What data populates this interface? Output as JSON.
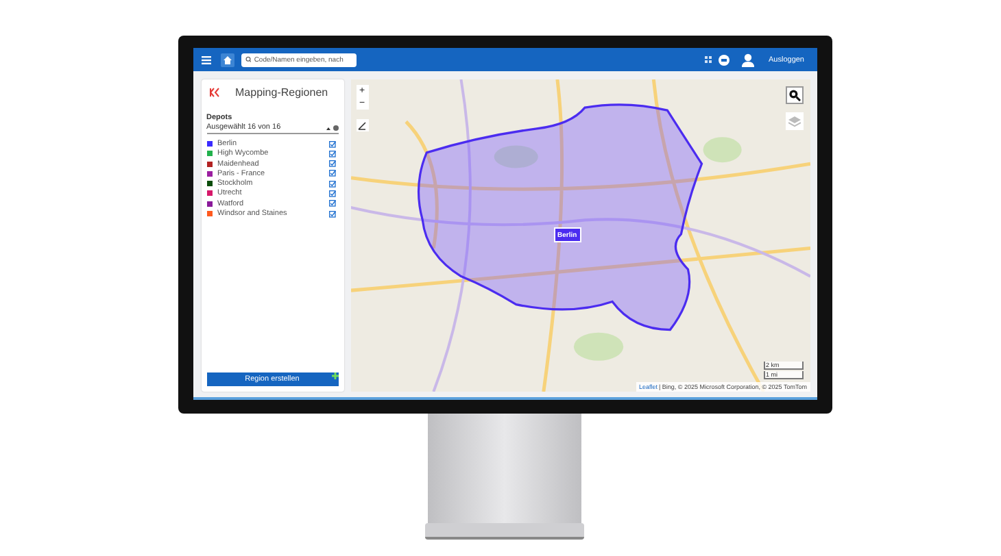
{
  "top_bar": {
    "search": {
      "placeholder": "Code/Namen eingeben, nach"
    },
    "logout": "Ausloggen"
  },
  "panel": {
    "title": "Mapping-Regionen",
    "depots_label": "Depots",
    "selection": "Ausgewählt 16 von 16",
    "depots": [
      {
        "name": "Berlin",
        "color": "#3a2bff",
        "checked": true
      },
      {
        "name": "High Wycombe",
        "color": "#22b14c",
        "checked": true
      },
      {
        "name": "Maidenhead",
        "color": "#b22222",
        "checked": true
      },
      {
        "name": "Paris - France",
        "color": "#9b1fa0",
        "checked": true
      },
      {
        "name": "Stockholm",
        "color": "#0b4d0b",
        "checked": true
      },
      {
        "name": "Utrecht",
        "color": "#d6186a",
        "checked": true
      },
      {
        "name": "Watford",
        "color": "#8a1a9a",
        "checked": true
      },
      {
        "name": "Windsor and Staines",
        "color": "#ff5a1f",
        "checked": true
      }
    ],
    "create_button": "Region erstellen"
  },
  "map": {
    "zoom_in": "+",
    "zoom_out": "−",
    "region_marker": "Berlin",
    "scale": [
      "2 km",
      "1 mi"
    ],
    "attribution_link": "Leaflet",
    "attribution": "| Bing, © 2025 Microsoft Corporation, © 2025 TomTom"
  }
}
